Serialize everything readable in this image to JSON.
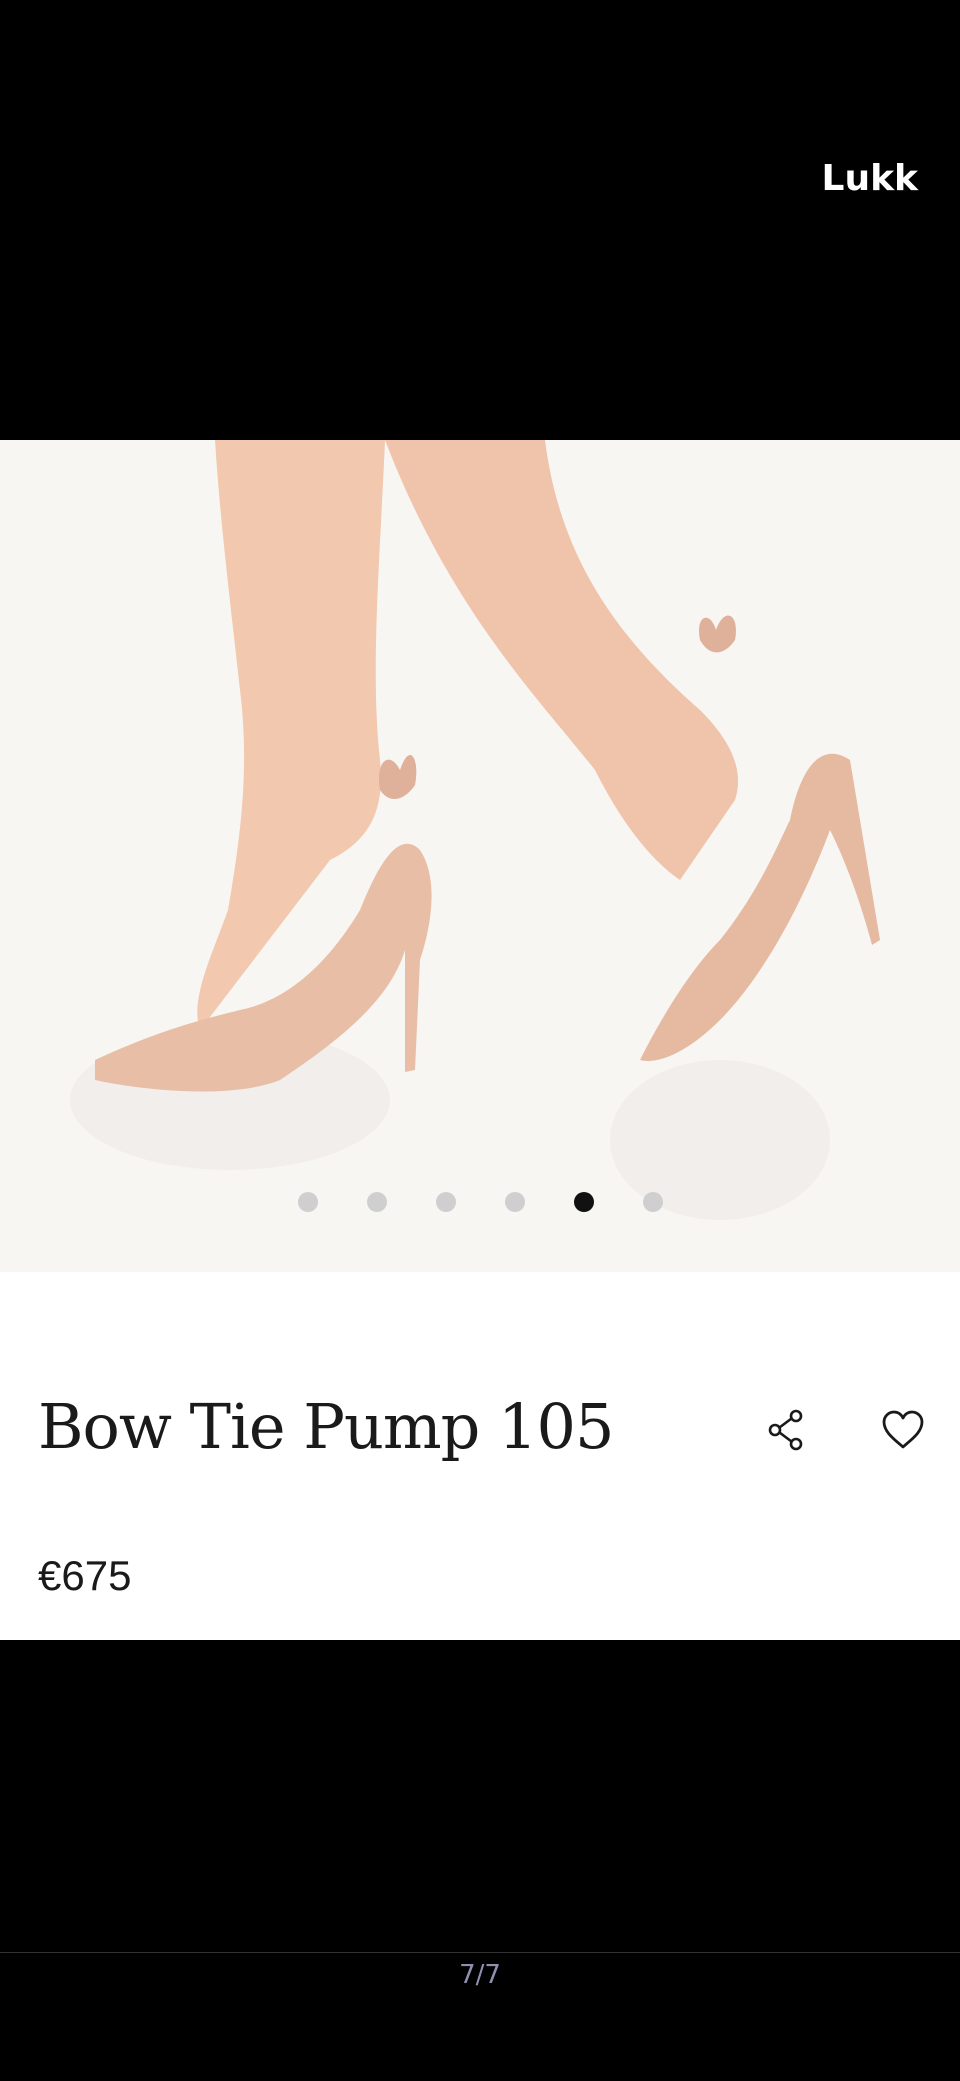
{
  "overlay": {
    "close_label": "Lukk"
  },
  "gallery": {
    "dot_count": 6,
    "active_index": 4
  },
  "product": {
    "name": "Bow Tie Pump 105",
    "price": "€675",
    "icons": {
      "share": "share-icon",
      "favorite": "heart-icon"
    }
  },
  "viewer": {
    "page_indicator": "7/7"
  },
  "colors": {
    "background": "#000000",
    "card": "#ffffff",
    "image_bg": "#f8f6f3",
    "skin": "#f2c8ae",
    "shoe": "#e8bea7",
    "active_dot": "#111111",
    "inactive_dot": "#cfcfcf"
  }
}
